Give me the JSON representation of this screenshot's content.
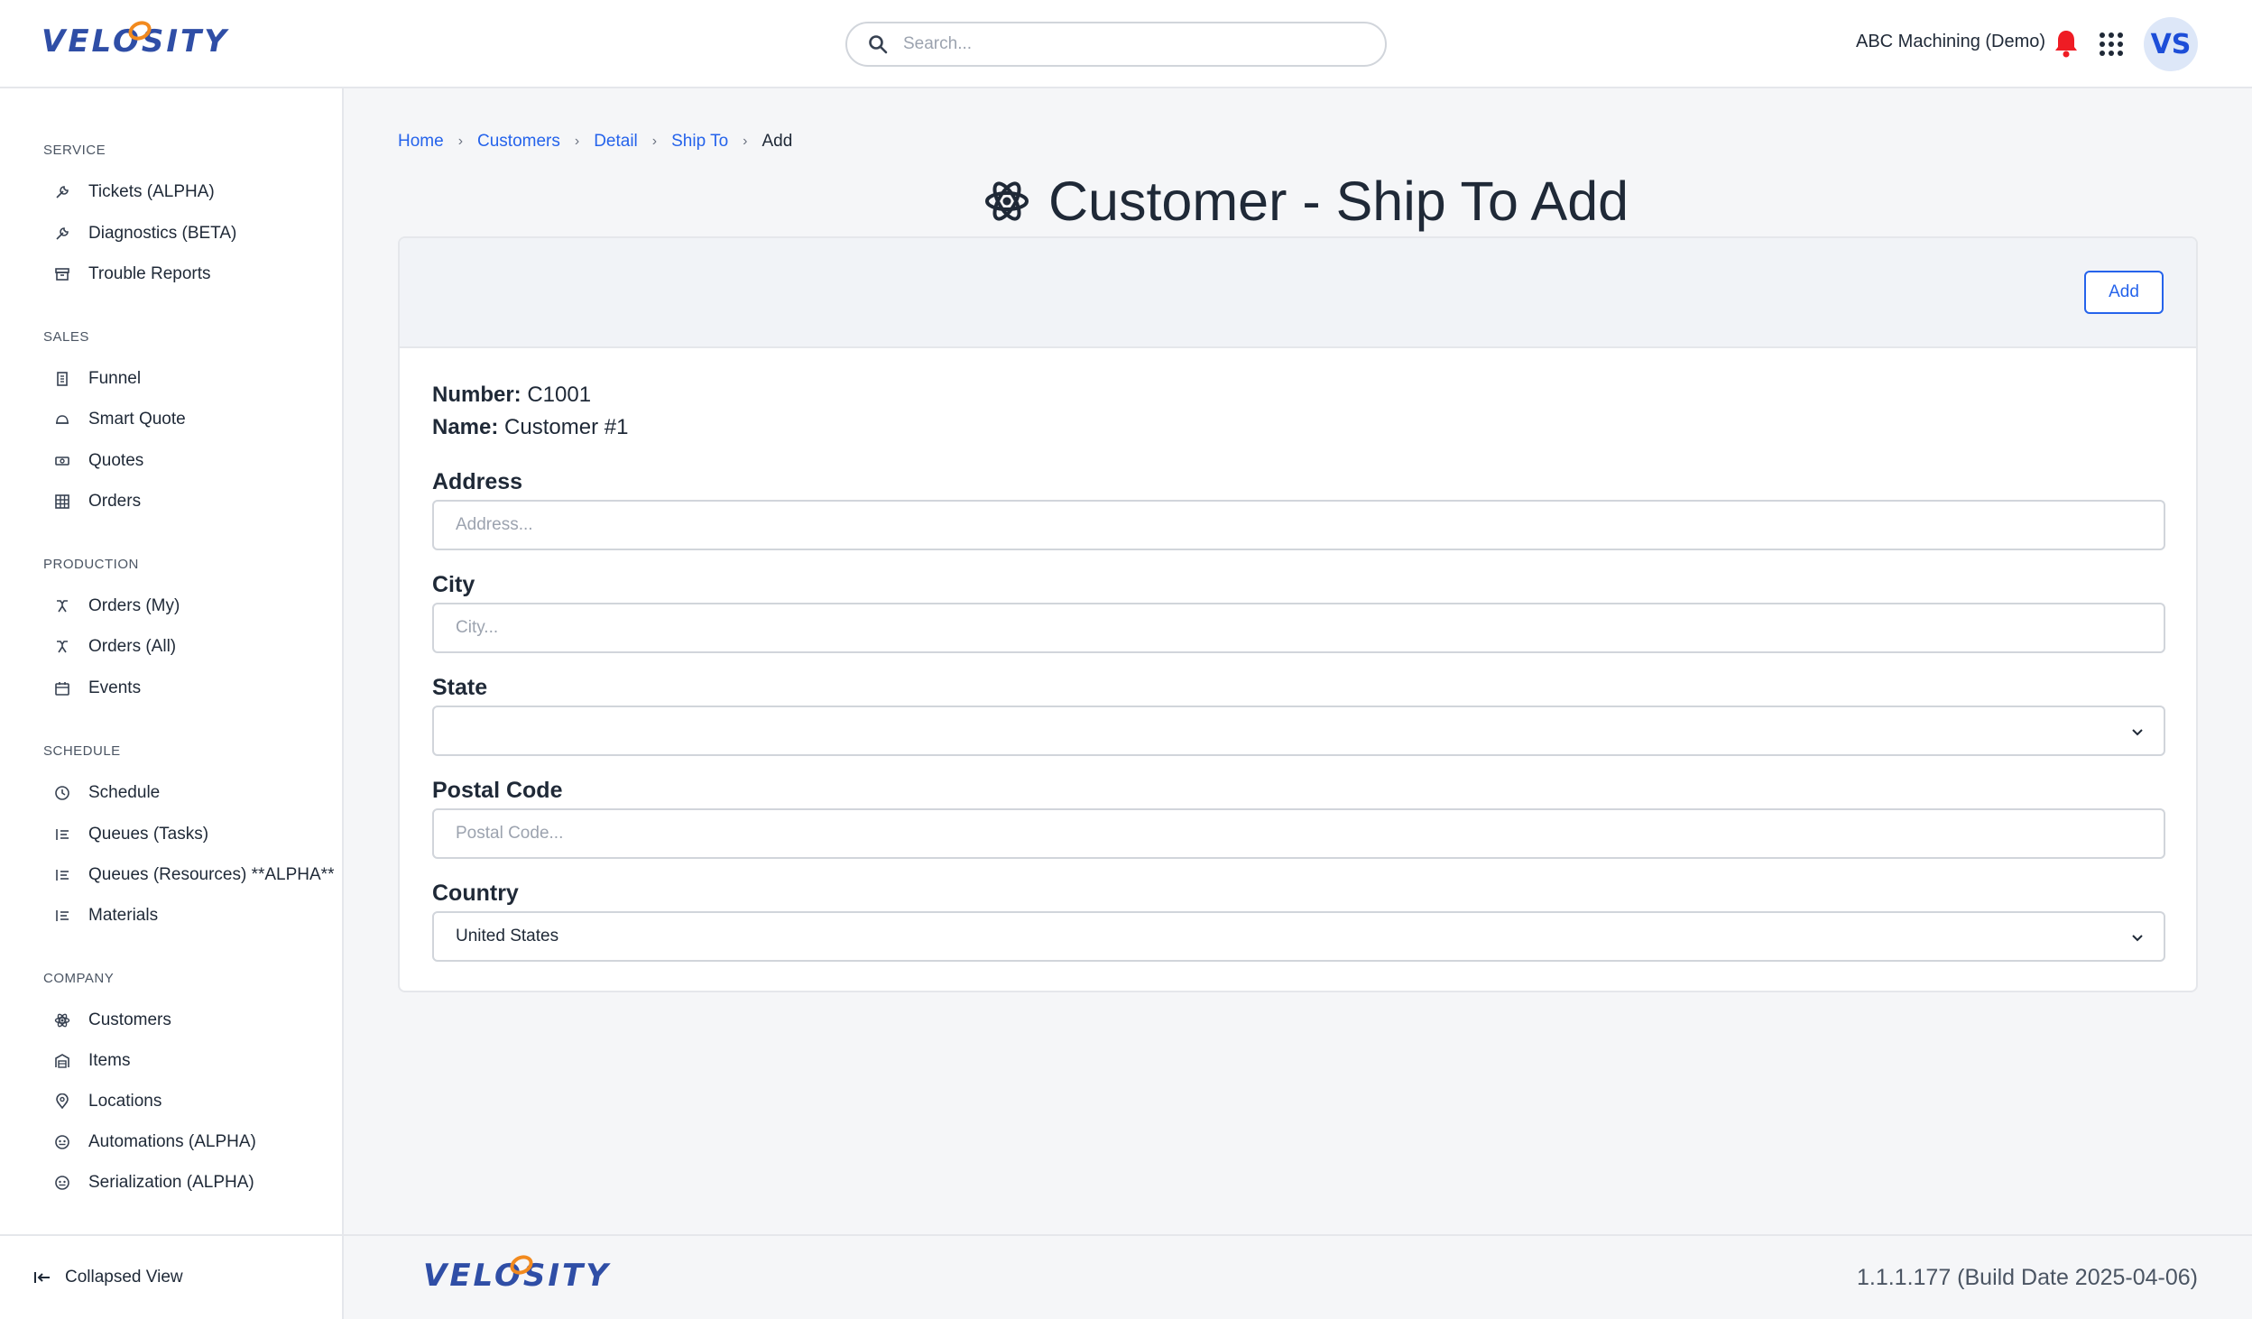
{
  "brand": {
    "logo_text": "VELOSITY"
  },
  "header": {
    "search_placeholder": "Search...",
    "org_name": "ABC Machining (Demo)",
    "avatar_initials": "VS",
    "bell_color": "#ef1c24",
    "accent": "#2563eb"
  },
  "sidebar": {
    "sections": [
      {
        "title": "SERVICE",
        "items": [
          {
            "label": "Tickets (ALPHA)",
            "icon": "wrench-icon"
          },
          {
            "label": "Diagnostics (BETA)",
            "icon": "wrench-icon"
          },
          {
            "label": "Trouble Reports",
            "icon": "archive-icon"
          }
        ]
      },
      {
        "title": "SALES",
        "items": [
          {
            "label": "Funnel",
            "icon": "building-icon"
          },
          {
            "label": "Smart Quote",
            "icon": "hardhat-icon"
          },
          {
            "label": "Quotes",
            "icon": "money-icon"
          },
          {
            "label": "Orders",
            "icon": "grid-icon"
          }
        ]
      },
      {
        "title": "PRODUCTION",
        "items": [
          {
            "label": "Orders (My)",
            "icon": "tool-icon"
          },
          {
            "label": "Orders (All)",
            "icon": "tool-icon"
          },
          {
            "label": "Events",
            "icon": "calendar-icon"
          }
        ]
      },
      {
        "title": "SCHEDULE",
        "items": [
          {
            "label": "Schedule",
            "icon": "clock-icon"
          },
          {
            "label": "Queues (Tasks)",
            "icon": "list-icon"
          },
          {
            "label": "Queues (Resources) **ALPHA**",
            "icon": "list-icon"
          },
          {
            "label": "Materials",
            "icon": "list-icon"
          }
        ]
      },
      {
        "title": "COMPANY",
        "items": [
          {
            "label": "Customers",
            "icon": "atom-icon"
          },
          {
            "label": "Items",
            "icon": "warehouse-icon"
          },
          {
            "label": "Locations",
            "icon": "pin-icon"
          },
          {
            "label": "Automations (ALPHA)",
            "icon": "robot-icon"
          },
          {
            "label": "Serialization (ALPHA)",
            "icon": "robot-icon"
          }
        ]
      }
    ],
    "collapse_label": "Collapsed View"
  },
  "breadcrumb": [
    "Home",
    "Customers",
    "Detail",
    "Ship To",
    "Add"
  ],
  "page": {
    "title": "Customer - Ship To Add",
    "add_button": "Add",
    "number_label": "Number:",
    "number_value": "C1001",
    "name_label": "Name:",
    "name_value": "Customer #1"
  },
  "form": {
    "address": {
      "label": "Address",
      "placeholder": "Address...",
      "value": ""
    },
    "city": {
      "label": "City",
      "placeholder": "City...",
      "value": ""
    },
    "state": {
      "label": "State",
      "value": ""
    },
    "postal_code": {
      "label": "Postal Code",
      "placeholder": "Postal Code...",
      "value": ""
    },
    "country": {
      "label": "Country",
      "value": "United States"
    }
  },
  "footer": {
    "version": "1.1.1.177 (Build Date 2025-04-06)"
  }
}
